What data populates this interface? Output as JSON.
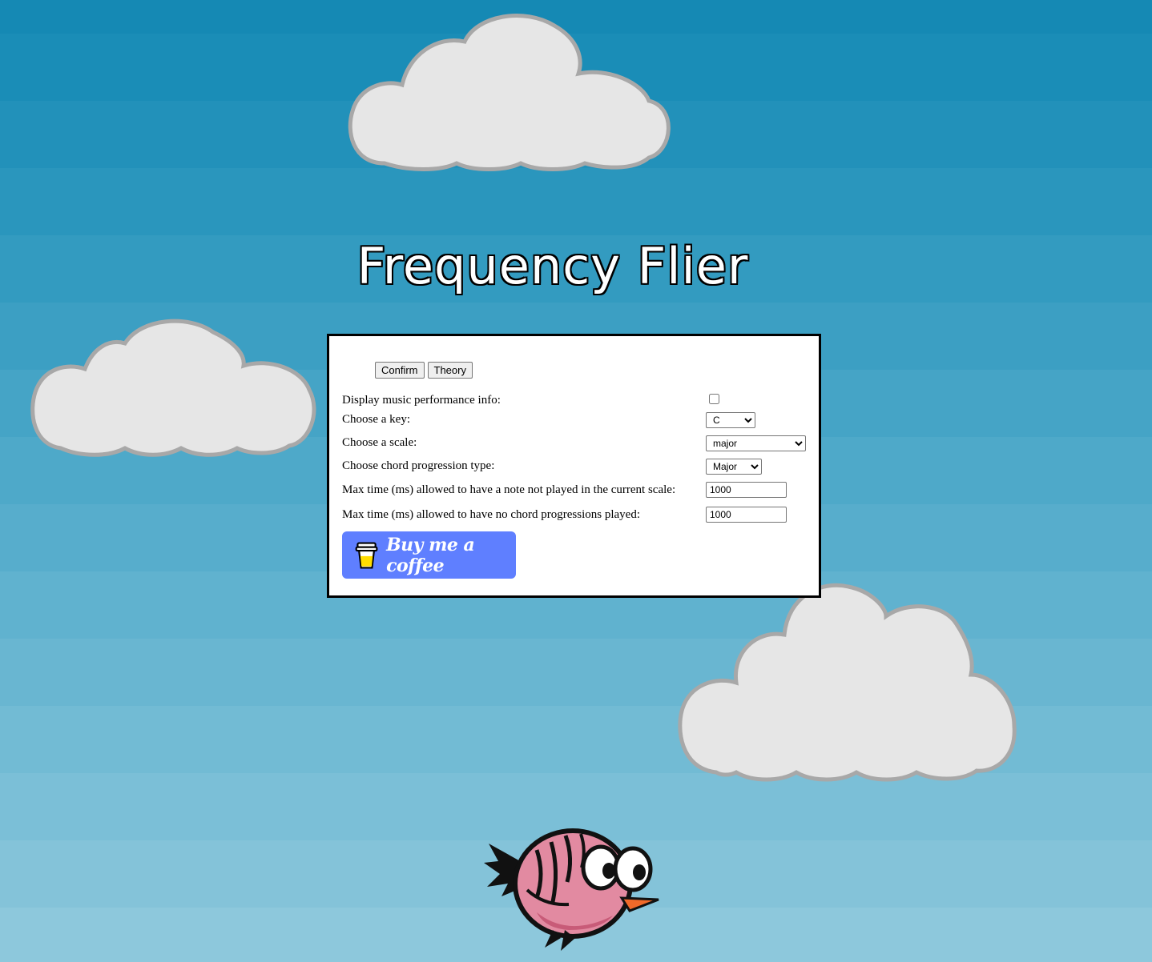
{
  "game": {
    "title": "Frequency Flier"
  },
  "settings": {
    "confirm_label": "Confirm",
    "theory_label": "Theory",
    "display_info_label": "Display music performance info:",
    "display_info_checked": false,
    "key_label": "Choose a key:",
    "key_value": "C",
    "scale_label": "Choose a scale:",
    "scale_value": "major",
    "chord_label": "Choose chord progression type:",
    "chord_value": "Major",
    "max_note_label": "Max time (ms) allowed to have a note not played in the current scale:",
    "max_note_value": "1000",
    "max_chord_label": "Max time (ms) allowed to have no chord progressions played:",
    "max_chord_value": "1000"
  },
  "donate": {
    "label": "Buy me a coffee"
  },
  "colors": {
    "sky_top": "#1589b4",
    "sky_bottom": "#8dc8dc",
    "cloud": "#e6e6e6",
    "button_blue": "#5f7fff"
  }
}
